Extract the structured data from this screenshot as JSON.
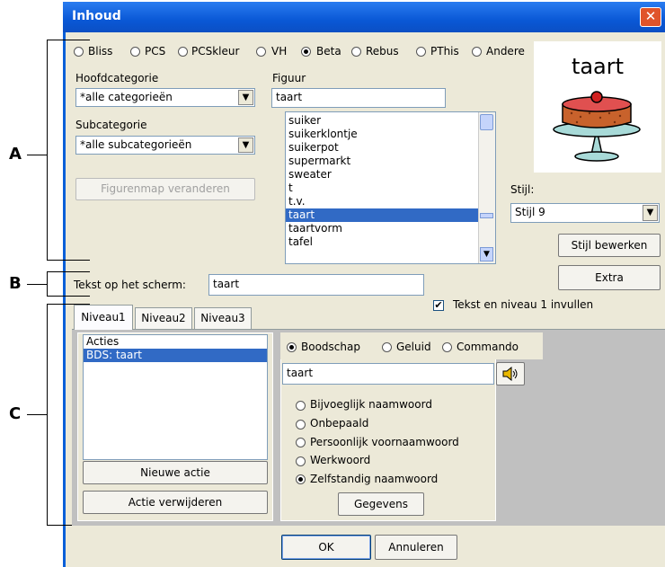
{
  "window": {
    "title": "Inhoud",
    "close_glyph": "✕"
  },
  "symbol_sets": {
    "options": [
      {
        "label": "Bliss",
        "selected": false
      },
      {
        "label": "PCS",
        "selected": false
      },
      {
        "label": "PCSkleur",
        "selected": false
      },
      {
        "label": "VH",
        "selected": false
      },
      {
        "label": "Beta",
        "selected": true
      },
      {
        "label": "Rebus",
        "selected": false
      },
      {
        "label": "PThis",
        "selected": false
      },
      {
        "label": "Andere",
        "selected": false
      }
    ]
  },
  "preview": {
    "title": "taart",
    "image": "cake-picture"
  },
  "hoofdcategorie": {
    "label": "Hoofdcategorie",
    "value": "*alle categorieën"
  },
  "subcategorie": {
    "label": "Subcategorie",
    "value": "*alle subcategorieën"
  },
  "figuur": {
    "label": "Figuur",
    "value": "taart"
  },
  "figurenmap_button": "Figurenmap veranderen",
  "figure_list": {
    "items": [
      "suiker",
      "suikerklontje",
      "suikerpot",
      "supermarkt",
      "sweater",
      "t",
      "t.v.",
      "taart",
      "taartvorm",
      "tafel"
    ],
    "selected_index": 7
  },
  "stijl": {
    "label": "Stijl:",
    "value": "Stijl 9",
    "edit_button": "Stijl bewerken"
  },
  "extra_button": "Extra",
  "screen_text": {
    "label": "Tekst op het scherm:",
    "value": "taart"
  },
  "fill_checkbox": {
    "label": "Tekst en niveau 1 invullen",
    "checked": true,
    "mark": "✔"
  },
  "tabs": [
    {
      "label": "Niveau1",
      "active": true
    },
    {
      "label": "Niveau2",
      "active": false
    },
    {
      "label": "Niveau3",
      "active": false
    }
  ],
  "actions": {
    "header": "Acties",
    "items": [
      "BDS: taart"
    ],
    "new_button": "Nieuwe actie",
    "delete_button": "Actie verwijderen"
  },
  "action_type": {
    "options": [
      {
        "label": "Boodschap",
        "selected": true
      },
      {
        "label": "Geluid",
        "selected": false
      },
      {
        "label": "Commando",
        "selected": false
      }
    ]
  },
  "message": {
    "value": "taart",
    "speaker_icon": "speaker-icon"
  },
  "word_type": {
    "options": [
      {
        "label": "Bijvoeglijk naamwoord",
        "selected": false
      },
      {
        "label": "Onbepaald",
        "selected": false
      },
      {
        "label": "Persoonlijk voornaamwoord",
        "selected": false
      },
      {
        "label": "Werkwoord",
        "selected": false
      },
      {
        "label": "Zelfstandig naamwoord",
        "selected": true
      }
    ]
  },
  "gegevens_button": "Gegevens",
  "ok_button": "OK",
  "cancel_button": "Annuleren",
  "callouts": {
    "a": "A",
    "b": "B",
    "c": "C"
  },
  "colors": {
    "title_bar": "#0a58d6",
    "selection": "#316ac5",
    "dialog": "#ece9d8"
  }
}
